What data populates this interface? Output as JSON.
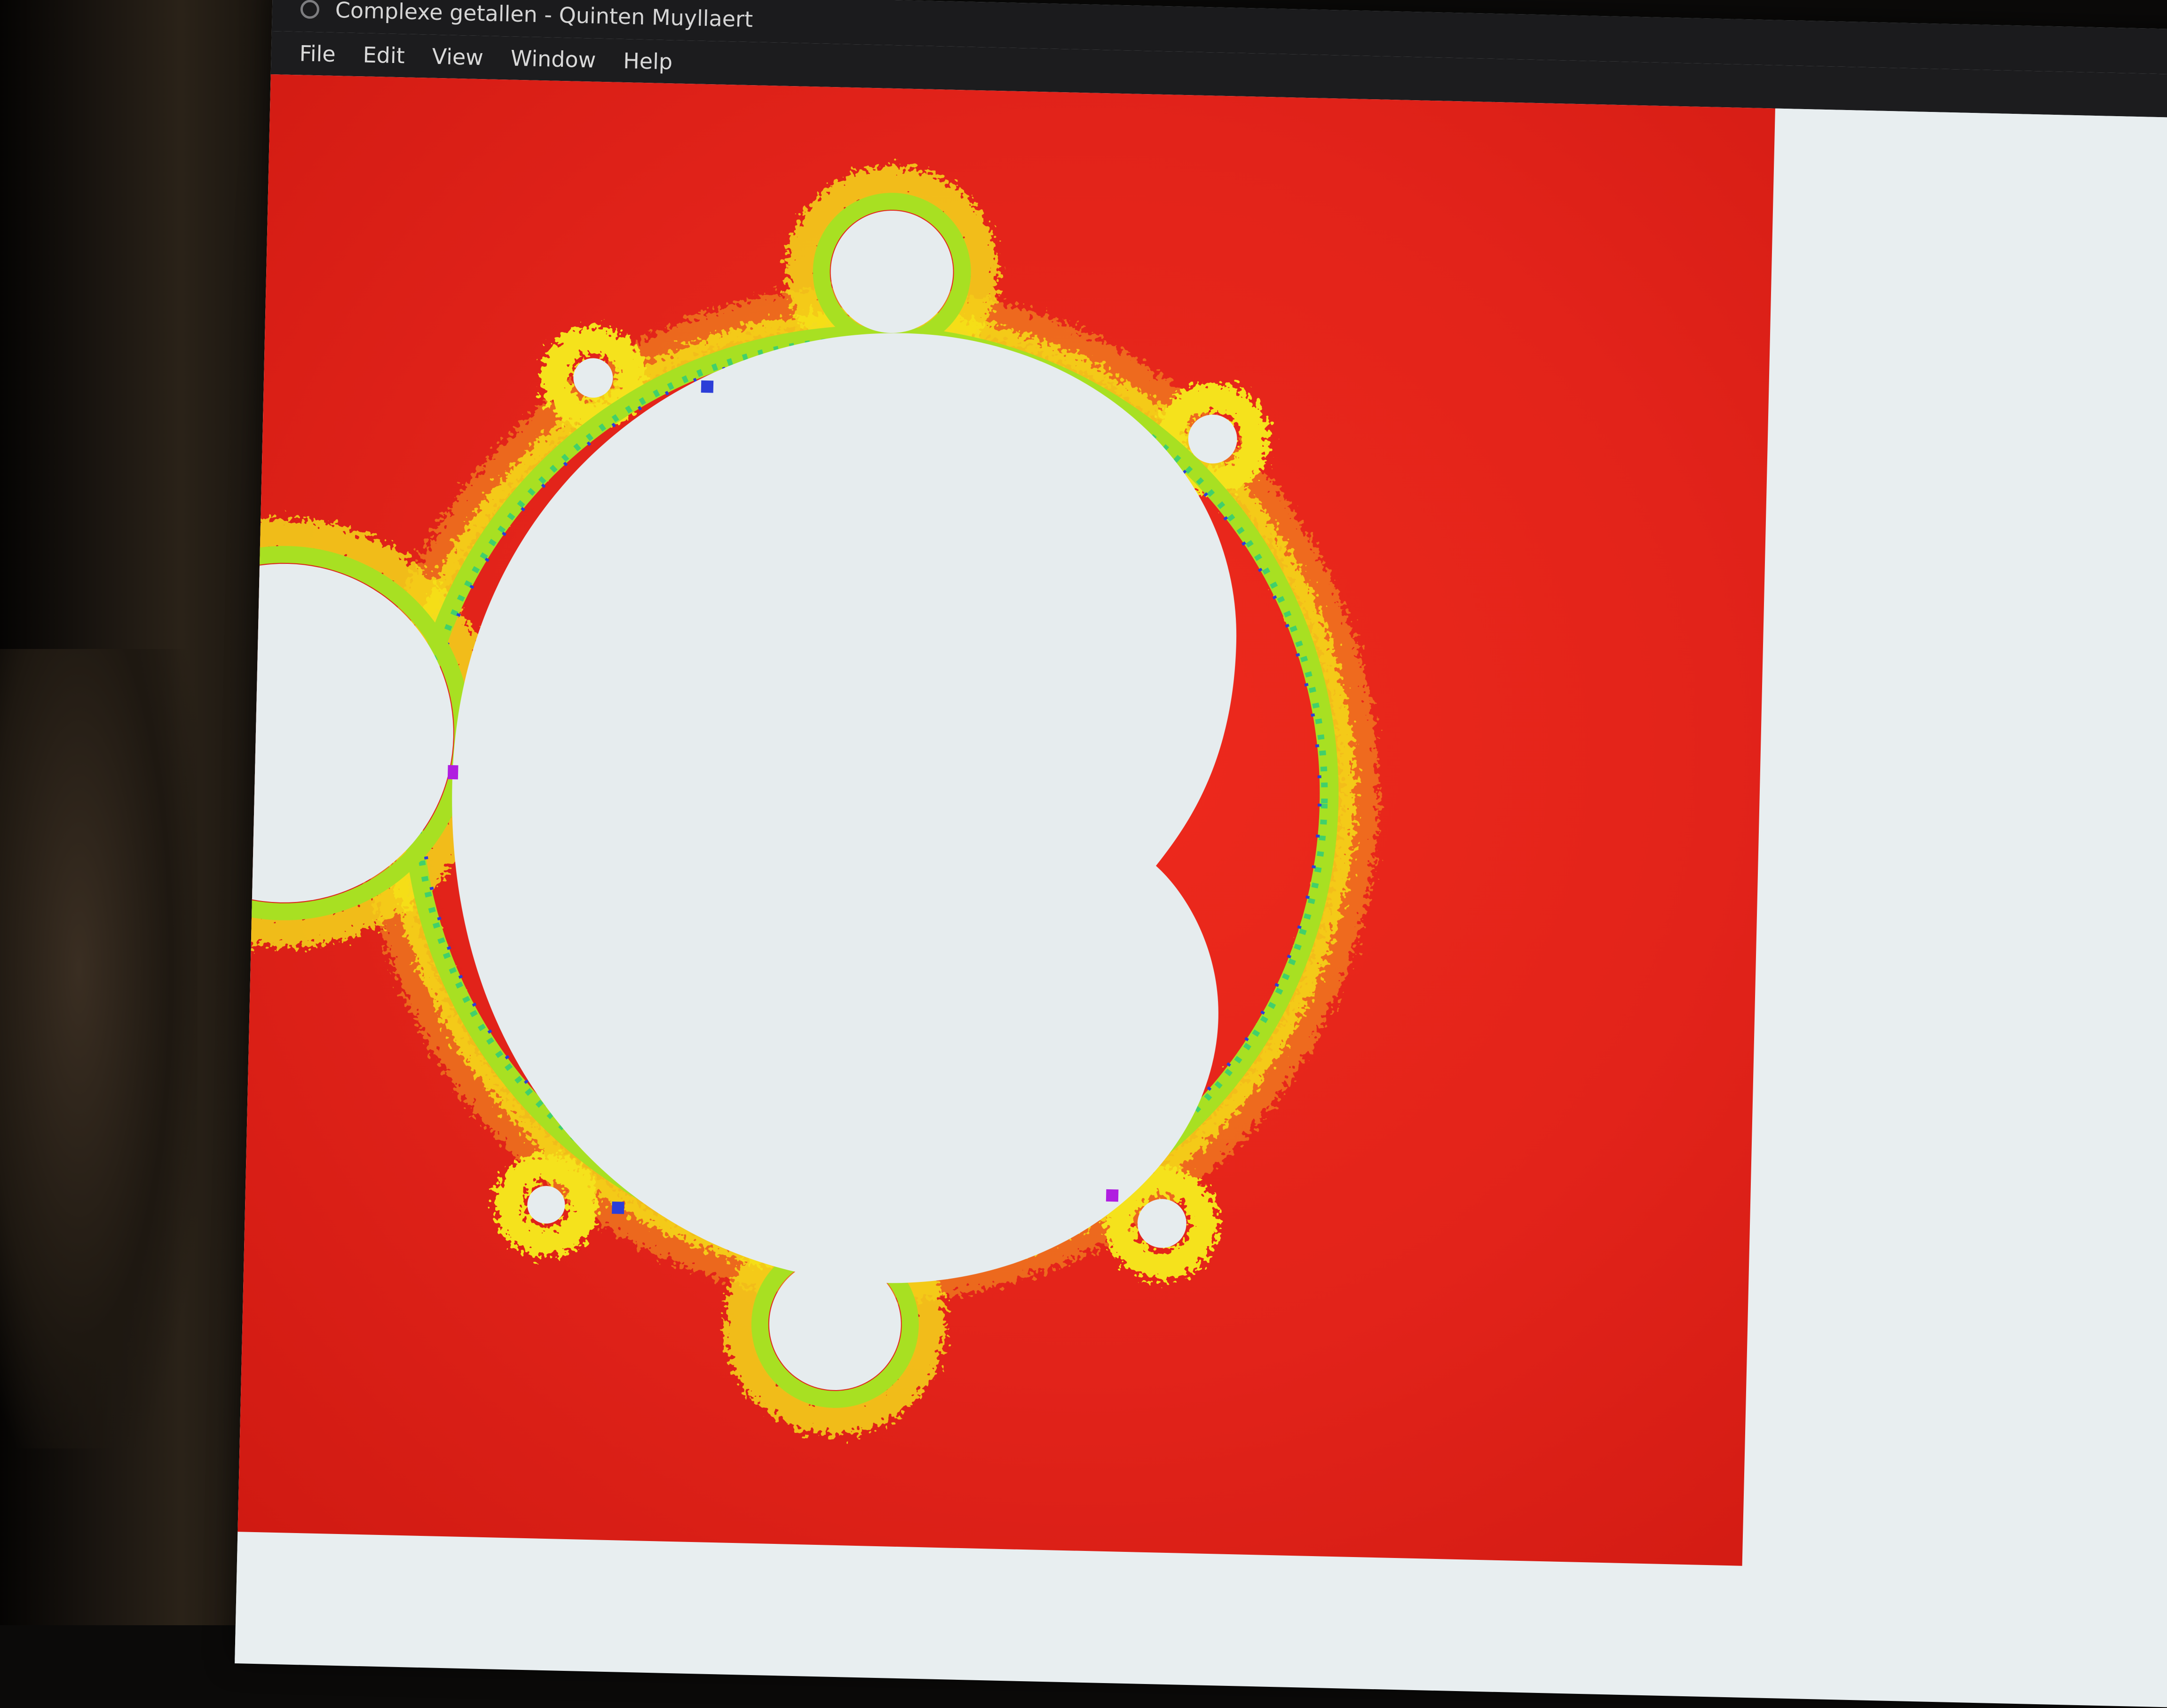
{
  "window": {
    "title": "Complexe getallen - Quinten Muyllaert"
  },
  "menu": {
    "items": [
      "File",
      "Edit",
      "View",
      "Window",
      "Help"
    ]
  },
  "fractal": {
    "name": "mandelbrot-set",
    "outside_color": "#e2231a",
    "interior_color": "#e6ecee",
    "boundary_colors": [
      "#f5e21a",
      "#a8e022",
      "#41d06b",
      "#2c3ed8",
      "#b01ee0",
      "#f4a11c"
    ]
  }
}
